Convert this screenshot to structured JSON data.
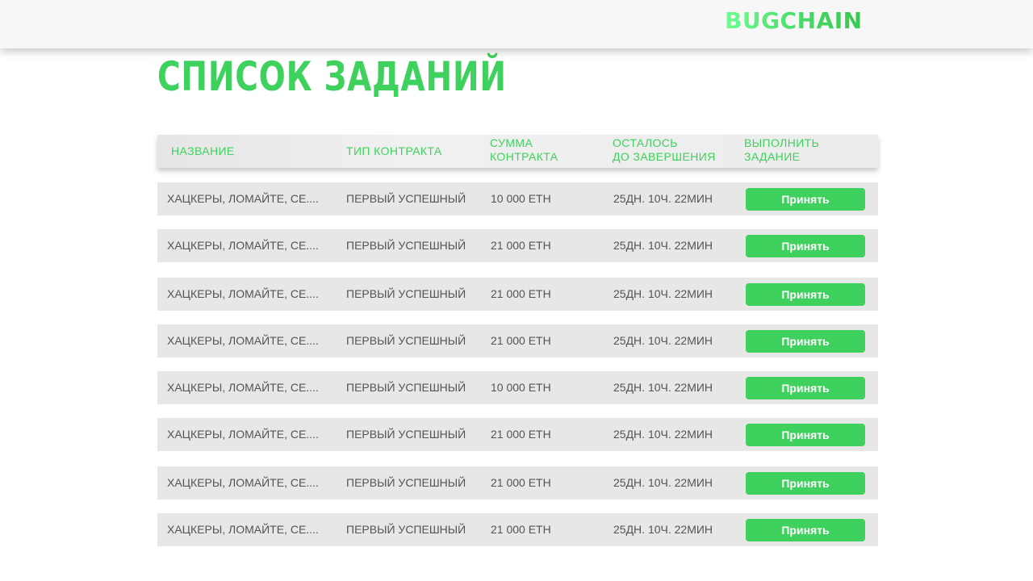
{
  "header": {
    "logo_text": "BUGCHAIN"
  },
  "main": {
    "title": "СПИСОК ЗАДАНИЙ"
  },
  "table": {
    "columns": {
      "name": "НАЗВАНИЕ",
      "type": "ТИП КОНТРАКТА",
      "sum": "СУММА\nКОНТРАКТА",
      "remaining": "ОСТАЛОСЬ\nДО ЗАВЕРШЕНИЯ",
      "action": "ВЫПОЛНИТЬ\nЗАДАНИЕ"
    },
    "rows": [
      {
        "name": "ХАЦКЕРЫ, ЛОМАЙТЕ, СЕ....",
        "type": "ПЕРВЫЙ УСПЕШНЫЙ",
        "sum": "10 000 ETH",
        "remaining": "25ДН. 10Ч. 22МИН",
        "action": "Принять"
      },
      {
        "name": "ХАЦКЕРЫ, ЛОМАЙТЕ, СЕ....",
        "type": "ПЕРВЫЙ УСПЕШНЫЙ",
        "sum": "21 000 ETH",
        "remaining": "25ДН. 10Ч. 22МИН",
        "action": "Принять"
      },
      {
        "name": "ХАЦКЕРЫ, ЛОМАЙТЕ, СЕ....",
        "type": "ПЕРВЫЙ УСПЕШНЫЙ",
        "sum": "21 000 ETH",
        "remaining": "25ДН. 10Ч. 22МИН",
        "action": "Принять"
      },
      {
        "name": "ХАЦКЕРЫ, ЛОМАЙТЕ, СЕ....",
        "type": "ПЕРВЫЙ УСПЕШНЫЙ",
        "sum": "21 000 ETH",
        "remaining": "25ДН. 10Ч. 22МИН",
        "action": "Принять"
      },
      {
        "name": "ХАЦКЕРЫ, ЛОМАЙТЕ, СЕ....",
        "type": "ПЕРВЫЙ УСПЕШНЫЙ",
        "sum": "10 000 ETH",
        "remaining": "25ДН. 10Ч. 22МИН",
        "action": "Принять"
      },
      {
        "name": "ХАЦКЕРЫ, ЛОМАЙТЕ, СЕ....",
        "type": "ПЕРВЫЙ УСПЕШНЫЙ",
        "sum": "21 000 ETH",
        "remaining": "25ДН. 10Ч. 22МИН",
        "action": "Принять"
      },
      {
        "name": "ХАЦКЕРЫ, ЛОМАЙТЕ, СЕ....",
        "type": "ПЕРВЫЙ УСПЕШНЫЙ",
        "sum": "21 000 ETH",
        "remaining": "25ДН. 10Ч. 22МИН",
        "action": "Принять"
      },
      {
        "name": "ХАЦКЕРЫ, ЛОМАЙТЕ, СЕ....",
        "type": "ПЕРВЫЙ УСПЕШНЫЙ",
        "sum": "21 000 ETH",
        "remaining": "25ДН. 10Ч. 22МИН",
        "action": "Принять"
      }
    ]
  },
  "colors": {
    "accent": "#3ed15d",
    "row_background": "#e7e7e7",
    "topbar_background": "#f7f7f7",
    "text": "#545454"
  }
}
